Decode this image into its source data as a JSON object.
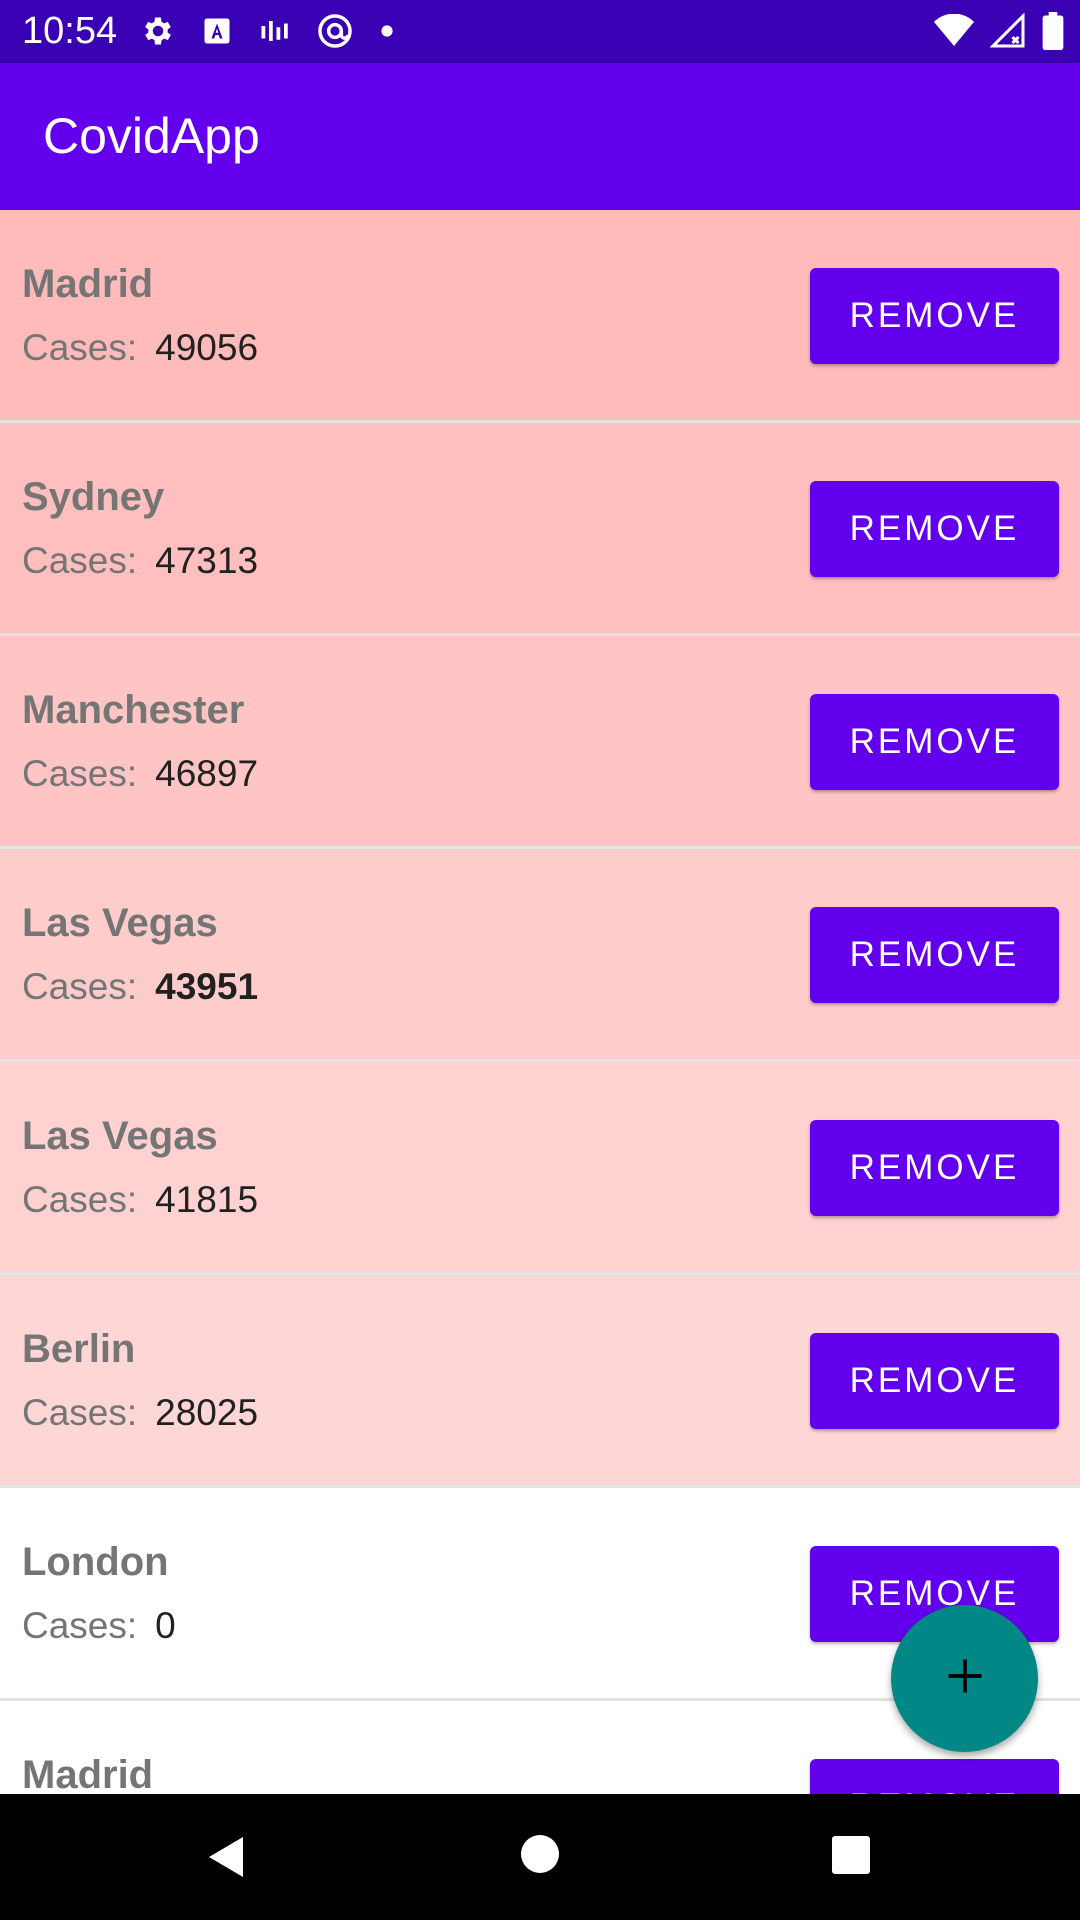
{
  "status_bar": {
    "time": "10:54",
    "background": "#3a00b3",
    "icons_left": [
      "settings-icon",
      "a-icon",
      "signal-bars-icon",
      "at-icon",
      "dot-icon"
    ],
    "icons_right": [
      "wifi-icon",
      "cellular-icon",
      "battery-icon"
    ]
  },
  "app_bar": {
    "title": "CovidApp",
    "background": "#6200ee"
  },
  "list": {
    "case_label": "Cases:",
    "remove_label": "REMOVE",
    "items": [
      {
        "city": "Madrid",
        "cases": "49056",
        "background": "#ffbaba",
        "cases_bold": false
      },
      {
        "city": "Sydney",
        "cases": "47313",
        "background": "#ffbfbf",
        "cases_bold": false
      },
      {
        "city": "Manchester",
        "cases": "46897",
        "background": "#ffc4c4",
        "cases_bold": false
      },
      {
        "city": "Las Vegas",
        "cases": "43951",
        "background": "#ffcccc",
        "cases_bold": true
      },
      {
        "city": "Las Vegas",
        "cases": "41815",
        "background": "#ffd1d1",
        "cases_bold": false
      },
      {
        "city": "Berlin",
        "cases": "28025",
        "background": "#ffd6d6",
        "cases_bold": false
      },
      {
        "city": "London",
        "cases": "0",
        "background": "#ffffff",
        "cases_bold": false
      },
      {
        "city": "Madrid",
        "cases": "",
        "background": "#ffffff",
        "cases_bold": false
      }
    ]
  },
  "fab": {
    "icon": "plus-icon",
    "background": "#018786"
  },
  "nav_bar": {
    "icons": [
      "back-icon",
      "home-icon",
      "recents-icon"
    ]
  }
}
